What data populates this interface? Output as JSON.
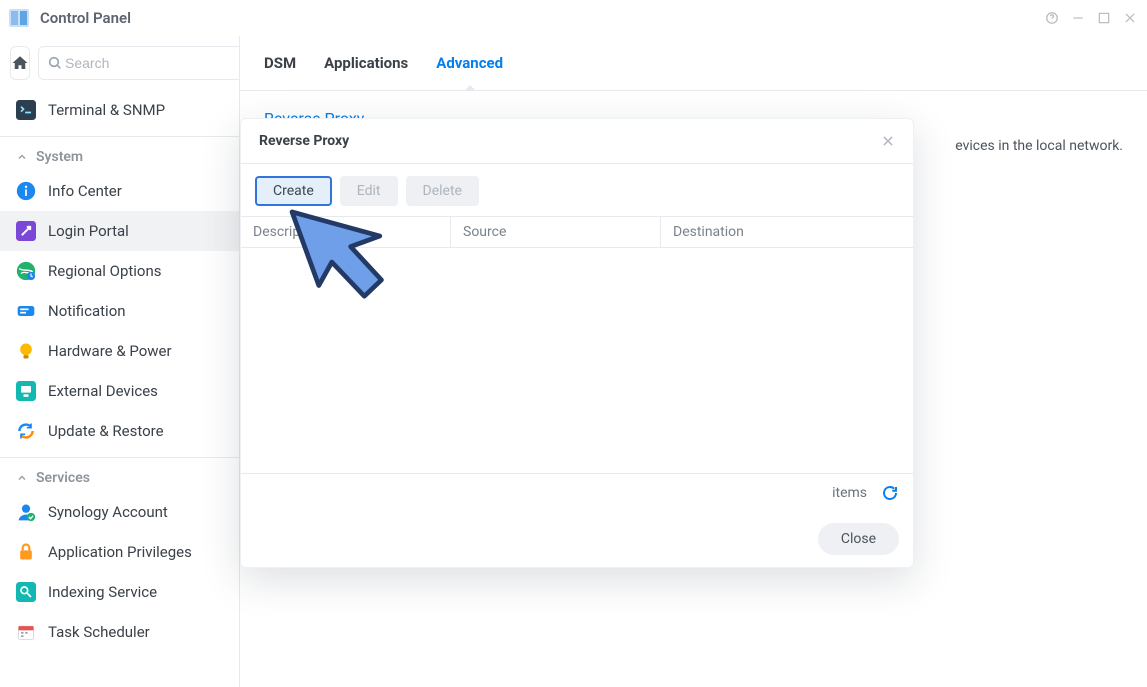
{
  "window": {
    "title": "Control Panel"
  },
  "search": {
    "placeholder": "Search"
  },
  "sidebar": {
    "terminal_label": "Terminal & SNMP",
    "section_system": "System",
    "section_services": "Services",
    "items_system": [
      {
        "label": "Info Center"
      },
      {
        "label": "Login Portal"
      },
      {
        "label": "Regional Options"
      },
      {
        "label": "Notification"
      },
      {
        "label": "Hardware & Power"
      },
      {
        "label": "External Devices"
      },
      {
        "label": "Update & Restore"
      }
    ],
    "items_services": [
      {
        "label": "Synology Account"
      },
      {
        "label": "Application Privileges"
      },
      {
        "label": "Indexing Service"
      },
      {
        "label": "Task Scheduler"
      }
    ]
  },
  "tabs": {
    "dsm": "DSM",
    "applications": "Applications",
    "advanced": "Advanced"
  },
  "panel": {
    "section_title": "Reverse Proxy",
    "section_desc_suffix": "evices in the local network."
  },
  "modal": {
    "title": "Reverse Proxy",
    "buttons": {
      "create": "Create",
      "edit": "Edit",
      "delete": "Delete"
    },
    "columns": {
      "description": "Description",
      "source": "Source",
      "destination": "Destination"
    },
    "status_items": "items",
    "close": "Close"
  }
}
